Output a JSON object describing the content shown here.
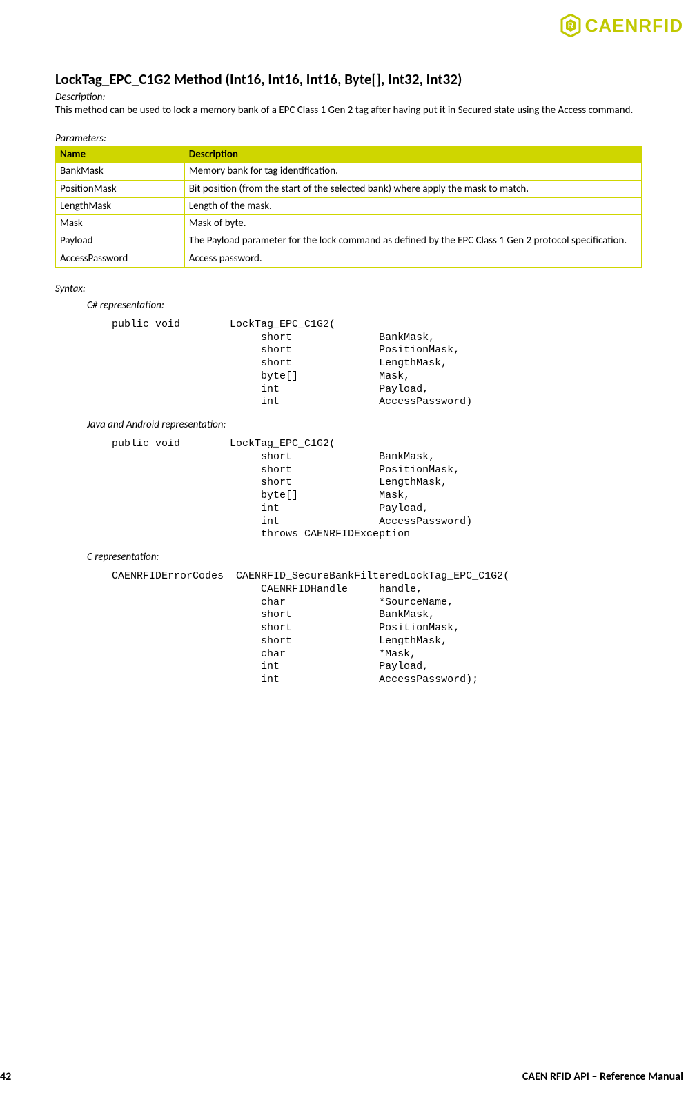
{
  "logo": {
    "text": "CAENRFID"
  },
  "method": {
    "title": "LockTag_EPC_C1G2 Method (Int16, Int16, Int16, Byte[], Int32, Int32)",
    "description_label": "Description:",
    "description_text": "This method can be used to lock a memory bank of a EPC Class 1 Gen 2 tag after having put it in Secured state using the Access command."
  },
  "parameters": {
    "label": "Parameters:",
    "headers": {
      "name": "Name",
      "desc": "Description"
    },
    "rows": [
      {
        "name": "BankMask",
        "desc": "Memory bank for tag identification."
      },
      {
        "name": "PositionMask",
        "desc": "Bit position (from the start of the selected bank) where apply the mask to match."
      },
      {
        "name": "LengthMask",
        "desc": "Length of the mask."
      },
      {
        "name": "Mask",
        "desc": "Mask of byte."
      },
      {
        "name": "Payload",
        "desc": "The Payload parameter for the lock command as defined by the EPC Class 1 Gen 2 protocol specification."
      },
      {
        "name": "AccessPassword",
        "desc": "Access password."
      }
    ]
  },
  "syntax": {
    "label": "Syntax:",
    "csharp": {
      "label": "C# representation:",
      "code": "public void        LockTag_EPC_C1G2(\n                        short              BankMask,\n                        short              PositionMask,\n                        short              LengthMask,\n                        byte[]             Mask,\n                        int                Payload,\n                        int                AccessPassword)"
    },
    "java": {
      "label": "Java and Android representation:",
      "code": "public void        LockTag_EPC_C1G2(\n                        short              BankMask,\n                        short              PositionMask,\n                        short              LengthMask,\n                        byte[]             Mask,\n                        int                Payload,\n                        int                AccessPassword)\n                        throws CAENRFIDException"
    },
    "c": {
      "label": "C representation:",
      "code": "CAENRFIDErrorCodes  CAENRFID_SecureBankFilteredLockTag_EPC_C1G2(\n                        CAENRFIDHandle     handle,\n                        char               *SourceName,\n                        short              BankMask,\n                        short              PositionMask,\n                        short              LengthMask,\n                        char               *Mask,\n                        int                Payload,\n                        int                AccessPassword);"
    }
  },
  "footer": {
    "page": "42",
    "title": "CAEN RFID API – Reference Manual"
  }
}
